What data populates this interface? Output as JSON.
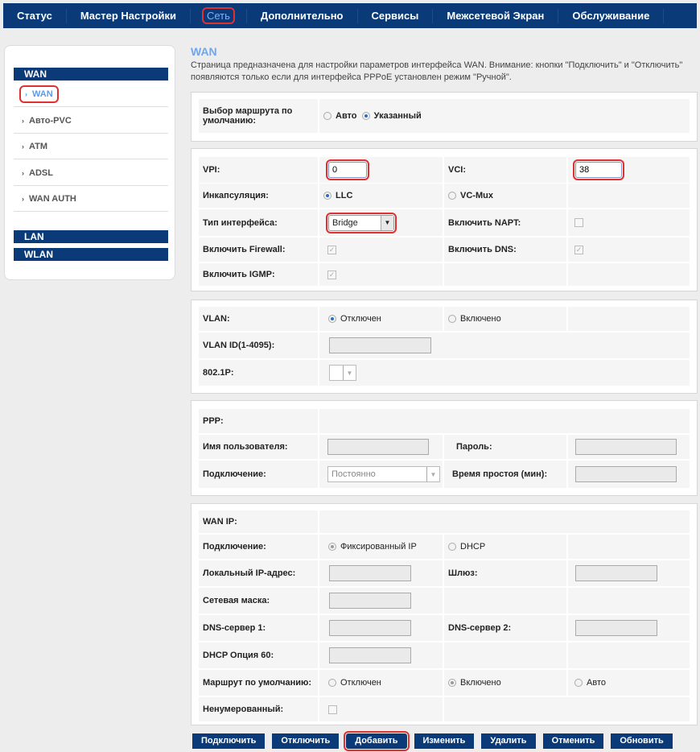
{
  "nav": [
    "Статус",
    "Мастер Настройки",
    "Сеть",
    "Дополнительно",
    "Сервисы",
    "Межсетевой Экран",
    "Обслуживание"
  ],
  "sidebar": {
    "groups": [
      "WAN",
      "LAN",
      "WLAN"
    ],
    "items": [
      "WAN",
      "Авто-PVC",
      "ATM",
      "ADSL",
      "WAN AUTH"
    ]
  },
  "page": {
    "title": "WAN",
    "description": "Страница предназначена для настройки параметров интерфейса WAN. Внимание: кнопки \"Подключить\" и \"Отключить\" появляются только если для интерфейса PPPoE установлен режим \"Ручной\"."
  },
  "route": {
    "label": "Выбор маршрута по умолчанию:",
    "opt_auto": "Авто",
    "opt_set": "Указанный"
  },
  "atm": {
    "vpi_label": "VPI:",
    "vpi": "0",
    "vci_label": "VCI:",
    "vci": "38",
    "encap_label": "Инкапсуляция:",
    "llc": "LLC",
    "vcmux": "VC-Mux",
    "iftype_label": "Тип интерфейса:",
    "iftype": "Bridge",
    "napt_label": "Включить NAPT:",
    "firewall_label": "Включить Firewall:",
    "dns_label": "Включить DNS:",
    "igmp_label": "Включить IGMP:"
  },
  "vlan": {
    "label": "VLAN:",
    "off": "Отключен",
    "on": "Включено",
    "id_label": "VLAN ID(1-4095):",
    "p_label": "802.1P:"
  },
  "ppp": {
    "title": "PPP:",
    "user_label": "Имя пользователя:",
    "pass_label": "Пароль:",
    "conn_label": "Подключение:",
    "conn": "Постоянно",
    "idle_label": "Время простоя (мин):"
  },
  "wanip": {
    "title": "WAN IP:",
    "conn_label": "Подключение:",
    "fixed": "Фиксированный IP",
    "dhcp": "DHCP",
    "local_label": "Локальный IP-адрес:",
    "gw_label": "Шлюз:",
    "mask_label": "Сетевая маска:",
    "dns1_label": "DNS-сервер 1:",
    "dns2_label": "DNS-сервер 2:",
    "opt60_label": "DHCP Опция 60:",
    "defroute_label": "Маршрут по умолчанию:",
    "dr_off": "Отключен",
    "dr_on": "Включено",
    "dr_auto": "Авто",
    "unnum_label": "Ненумерованный:"
  },
  "buttons": [
    "Подключить",
    "Отключить",
    "Добавить",
    "Изменить",
    "Удалить",
    "Отменить",
    "Обновить"
  ],
  "colors": {
    "nav": "#0a3a78",
    "accent": "#6fa6ef",
    "highlight": "#e03030"
  }
}
